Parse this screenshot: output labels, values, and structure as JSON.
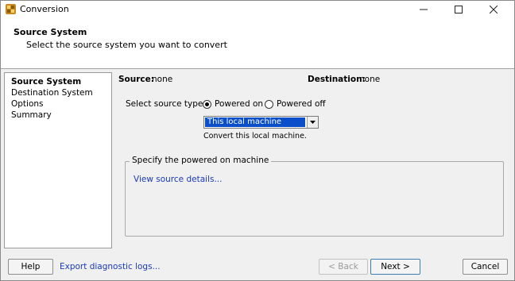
{
  "window": {
    "title": "Conversion",
    "icon": "conversion-app-icon",
    "controls": [
      "minimize",
      "maximize",
      "close"
    ]
  },
  "header": {
    "title": "Source System",
    "subtitle": "Select the source system you want to convert"
  },
  "nav": {
    "items": [
      {
        "label": "Source System",
        "active": true
      },
      {
        "label": "Destination System",
        "active": false
      },
      {
        "label": "Options",
        "active": false
      },
      {
        "label": "Summary",
        "active": false
      }
    ]
  },
  "info": {
    "source_label": "Source:",
    "source_value": "none",
    "destination_label": "Destination:",
    "destination_value": "none"
  },
  "source_type": {
    "label": "Select source type:",
    "options": [
      {
        "label": "Powered on",
        "selected": true
      },
      {
        "label": "Powered off",
        "selected": false
      }
    ]
  },
  "machine": {
    "selected": "This local machine",
    "description": "Convert this local machine."
  },
  "group": {
    "label": "Specify the powered on machine",
    "link": "View source details..."
  },
  "footer": {
    "help": "Help",
    "export": "Export diagnostic logs...",
    "back": "< Back",
    "next": "Next >",
    "cancel": "Cancel"
  },
  "colors": {
    "selection": "#0a4ec9",
    "link": "#1a3ab8",
    "background": "#f0f0f0"
  }
}
